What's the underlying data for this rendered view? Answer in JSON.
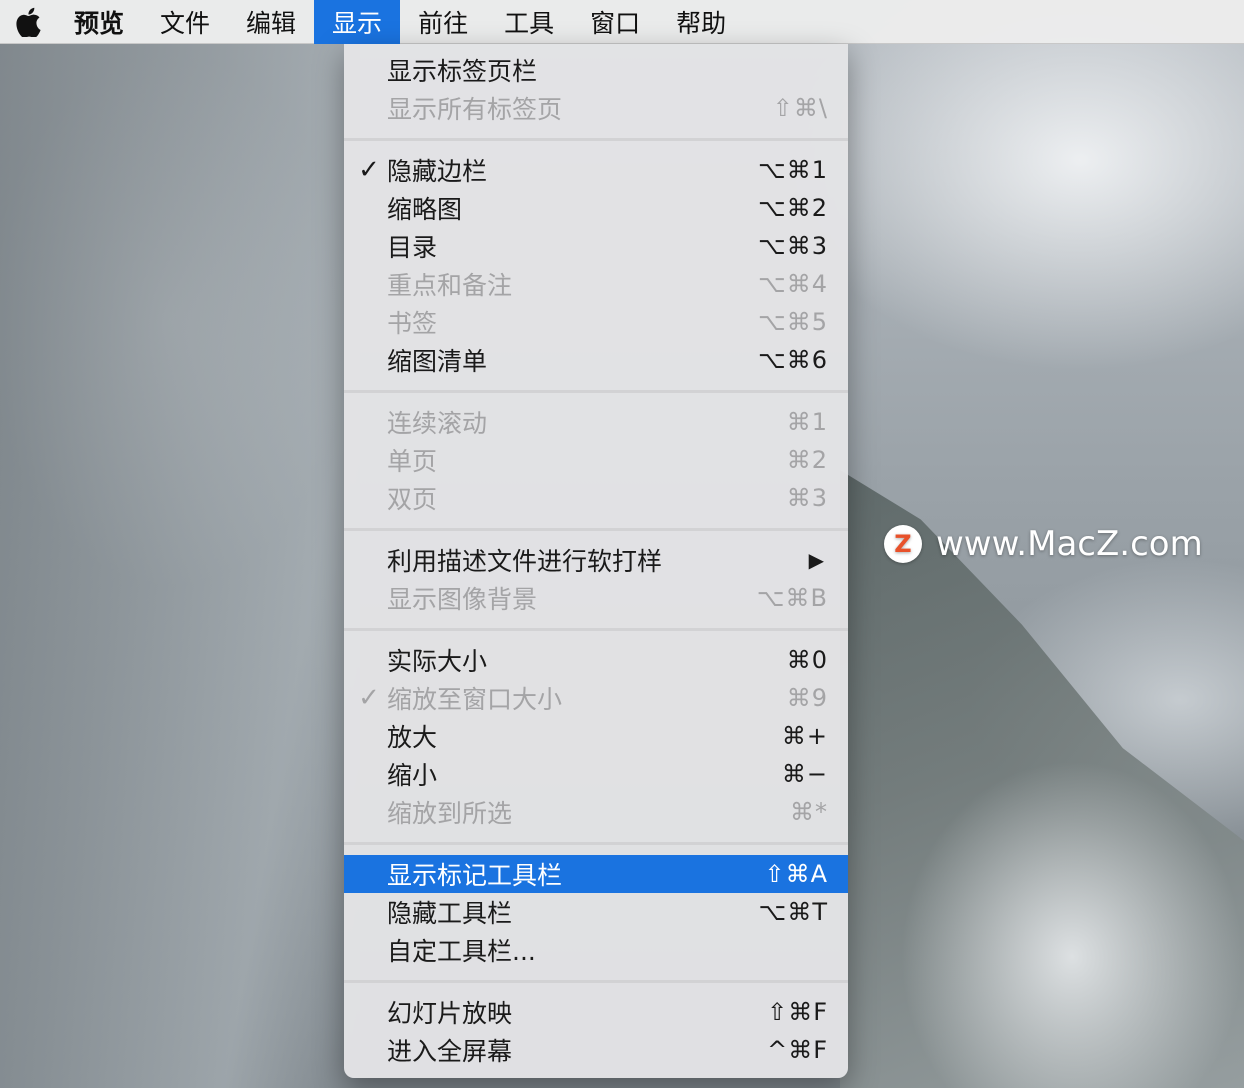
{
  "menubar": {
    "apple_icon": "apple-logo-icon",
    "items": [
      {
        "label": "预览"
      },
      {
        "label": "文件"
      },
      {
        "label": "编辑"
      },
      {
        "label": "显示"
      },
      {
        "label": "前往"
      },
      {
        "label": "工具"
      },
      {
        "label": "窗口"
      },
      {
        "label": "帮助"
      }
    ],
    "active_index": 3
  },
  "menu": {
    "check_symbol": "✓",
    "submenu_arrow": "▶",
    "items": [
      {
        "label": "显示标签页栏",
        "shortcut": ""
      },
      {
        "label": "显示所有标签页",
        "shortcut": "⇧⌘\\"
      },
      {
        "label": "隐藏边栏",
        "shortcut": "⌥⌘1"
      },
      {
        "label": "缩略图",
        "shortcut": "⌥⌘2"
      },
      {
        "label": "目录",
        "shortcut": "⌥⌘3"
      },
      {
        "label": "重点和备注",
        "shortcut": "⌥⌘4"
      },
      {
        "label": "书签",
        "shortcut": "⌥⌘5"
      },
      {
        "label": "缩图清单",
        "shortcut": "⌥⌘6"
      },
      {
        "label": "连续滚动",
        "shortcut": "⌘1"
      },
      {
        "label": "单页",
        "shortcut": "⌘2"
      },
      {
        "label": "双页",
        "shortcut": "⌘3"
      },
      {
        "label": "利用描述文件进行软打样",
        "shortcut": ""
      },
      {
        "label": "显示图像背景",
        "shortcut": "⌥⌘B"
      },
      {
        "label": "实际大小",
        "shortcut": "⌘0"
      },
      {
        "label": "缩放至窗口大小",
        "shortcut": "⌘9"
      },
      {
        "label": "放大",
        "shortcut": "⌘+"
      },
      {
        "label": "缩小",
        "shortcut": "⌘−"
      },
      {
        "label": "缩放到所选",
        "shortcut": "⌘*"
      },
      {
        "label": "显示标记工具栏",
        "shortcut": "⇧⌘A"
      },
      {
        "label": "隐藏工具栏",
        "shortcut": "⌥⌘T"
      },
      {
        "label": "自定工具栏...",
        "shortcut": ""
      },
      {
        "label": "幻灯片放映",
        "shortcut": "⇧⌘F"
      },
      {
        "label": "进入全屏幕",
        "shortcut": "^⌘F"
      }
    ]
  },
  "watermark": {
    "logo_letter": "Z",
    "text": "www.MacZ.com"
  },
  "colors": {
    "highlight": "#1a73e0",
    "disabled_text": "#a4a4a6",
    "watermark_logo": "#e8512a"
  }
}
